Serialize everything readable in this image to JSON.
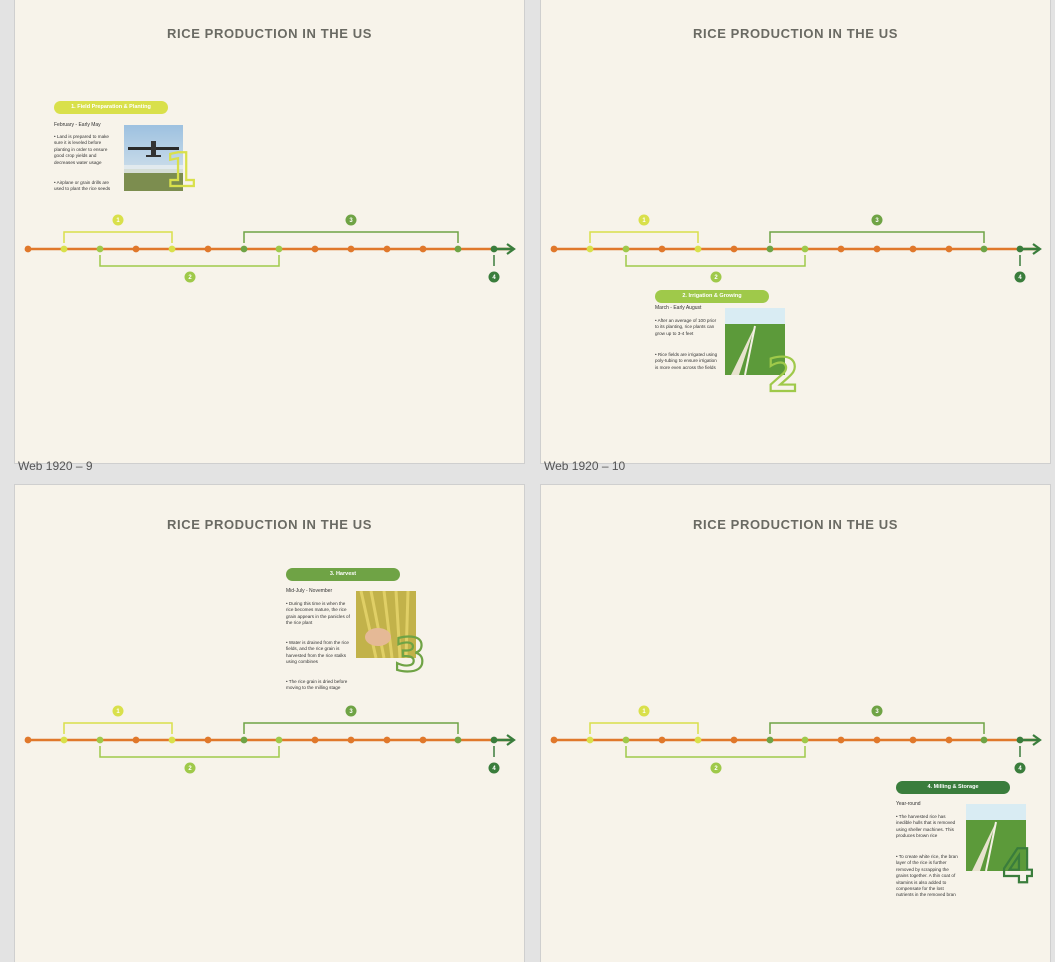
{
  "frames": [
    {
      "label": "",
      "title": "RICE PRODUCTION IN THE US"
    },
    {
      "label": "Web 1920 – 9",
      "title": "RICE PRODUCTION IN THE US"
    },
    {
      "label": "Web 1920 – 10",
      "title": "RICE PRODUCTION IN THE US"
    },
    {
      "label": "",
      "title": "RICE PRODUCTION IN THE US"
    }
  ],
  "timeline": {
    "markers": [
      "1",
      "2",
      "3",
      "4"
    ]
  },
  "cards": {
    "c1": {
      "title": "1. Field Preparation & Planting",
      "date": "February - Early May",
      "b1": "• Land is prepared to make sure it is leveled before planting in order to ensure good crop yields and decreases water usage",
      "b2": "• Airplane or grain drills are used to plant the rice seeds",
      "num": "1"
    },
    "c2": {
      "title": "2. Irrigation & Growing",
      "date": "March - Early August",
      "b1": "• After an average of 100 prior to its planting, rice plants can grow up to 3-4 feet",
      "b2": "• Rice fields are irrigated using poly-tubing to ensure irrigation is more even across the fields",
      "num": "2"
    },
    "c3": {
      "title": "3. Harvest",
      "date": "Mid-July - November",
      "b1": "• During this time is when the rice becomes mature, the rice grain appears in the panicles of the rice plant",
      "b2": "• Water is drained from the rice fields, and the rice grain is harvested from the rice stalks using combines",
      "b3": "• The rice grain is dried before moving to the milling stage",
      "num": "3"
    },
    "c4": {
      "title": "4. Milling & Storage",
      "date": "Year-round",
      "b1": "• The harvested rice has inedible hulls that is removed using sheller machines. This produces brown rice",
      "b2": "• To create white rice, the bran layer of the rice is further removed by scrapping the grains together. A thin coat of vitamins is also added to compensate for the lost nutrients in the removed bran",
      "num": "4"
    }
  },
  "colors": {
    "orange": "#e0782b",
    "yellow": "#d9e04b",
    "lightgreen": "#9fc94a",
    "green": "#6fa345",
    "darkgreen": "#3a7d3c",
    "background": "#f7f3ea",
    "canvas": "#e3e3e3"
  }
}
